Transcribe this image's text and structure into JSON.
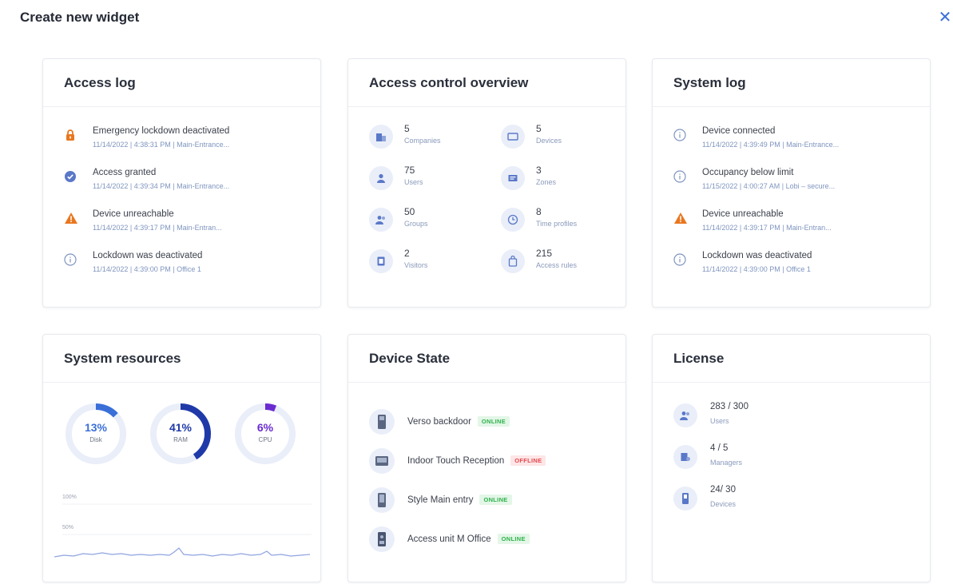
{
  "header": {
    "title": "Create new widget",
    "close_label": "✕"
  },
  "colors": {
    "accent": "#3a6fd8",
    "warning": "#e8771f",
    "online": "#2fb24b",
    "offline": "#e5484d",
    "ring_track": "#e9eef9"
  },
  "access_log": {
    "title": "Access log",
    "items": [
      {
        "icon": "lock-icon",
        "title": "Emergency lockdown deactivated",
        "meta": "11/14/2022 | 4:38:31 PM | Main-Entrance..."
      },
      {
        "icon": "check-circle-icon",
        "title": "Access granted",
        "meta": "11/14/2022 | 4:39:34 PM | Main-Entrance..."
      },
      {
        "icon": "warning-icon",
        "title": "Device unreachable",
        "meta": "11/14/2022 | 4:39:17 PM | Main-Entran..."
      },
      {
        "icon": "info-icon",
        "title": "Lockdown was deactivated",
        "meta": "11/14/2022 | 4:39:00 PM | Office 1"
      }
    ]
  },
  "access_overview": {
    "title": "Access control overview",
    "items": [
      {
        "icon": "building-icon",
        "value": "5",
        "label": "Companies"
      },
      {
        "icon": "device-icon",
        "value": "5",
        "label": "Devices"
      },
      {
        "icon": "user-icon",
        "value": "75",
        "label": "Users"
      },
      {
        "icon": "zone-icon",
        "value": "3",
        "label": "Zones"
      },
      {
        "icon": "group-icon",
        "value": "50",
        "label": "Groups"
      },
      {
        "icon": "clock-icon",
        "value": "8",
        "label": "Time profiles"
      },
      {
        "icon": "visitor-icon",
        "value": "2",
        "label": "Visitors"
      },
      {
        "icon": "access-rule-icon",
        "value": "215",
        "label": "Access rules"
      }
    ]
  },
  "system_log": {
    "title": "System log",
    "items": [
      {
        "icon": "info-icon",
        "title": "Device connected",
        "meta": "11/14/2022 | 4:39:49 PM | Main-Entrance..."
      },
      {
        "icon": "info-icon",
        "title": "Occupancy below limit",
        "meta": "11/15/2022 | 4:00:27 AM | Lobi – secure..."
      },
      {
        "icon": "warning-icon",
        "title": "Device unreachable",
        "meta": "11/14/2022 | 4:39:17 PM | Main-Entran..."
      },
      {
        "icon": "info-icon",
        "title": "Lockdown was deactivated",
        "meta": "11/14/2022 | 4:39:00 PM | Office 1"
      }
    ]
  },
  "system_resources": {
    "title": "System resources",
    "gauges": [
      {
        "value": "13%",
        "label": "Disk",
        "fraction": 0.13,
        "color": "#3a6fd8"
      },
      {
        "value": "41%",
        "label": "RAM",
        "fraction": 0.41,
        "color": "#1f3aa8"
      },
      {
        "value": "6%",
        "label": "CPU",
        "fraction": 0.06,
        "color": "#6a2bd1"
      }
    ],
    "graph": {
      "label_top": "100%",
      "label_mid": "50%"
    }
  },
  "device_state": {
    "title": "Device State",
    "items": [
      {
        "icon": "intercom-icon",
        "name": "Verso backdoor",
        "status": "ONLINE",
        "online": true
      },
      {
        "icon": "touch-panel-icon",
        "name": "Indoor Touch Reception",
        "status": "OFFLINE",
        "online": false
      },
      {
        "icon": "intercom-icon",
        "name": "Style Main entry",
        "status": "ONLINE",
        "online": true
      },
      {
        "icon": "access-unit-icon",
        "name": "Access unit M Office",
        "status": "ONLINE",
        "online": true
      }
    ]
  },
  "license": {
    "title": "License",
    "items": [
      {
        "icon": "users-icon",
        "value": "283 / 300",
        "label": "Users"
      },
      {
        "icon": "manager-icon",
        "value": "4 / 5",
        "label": "Managers"
      },
      {
        "icon": "device-license-icon",
        "value": "24/ 30",
        "label": "Devices"
      }
    ]
  }
}
